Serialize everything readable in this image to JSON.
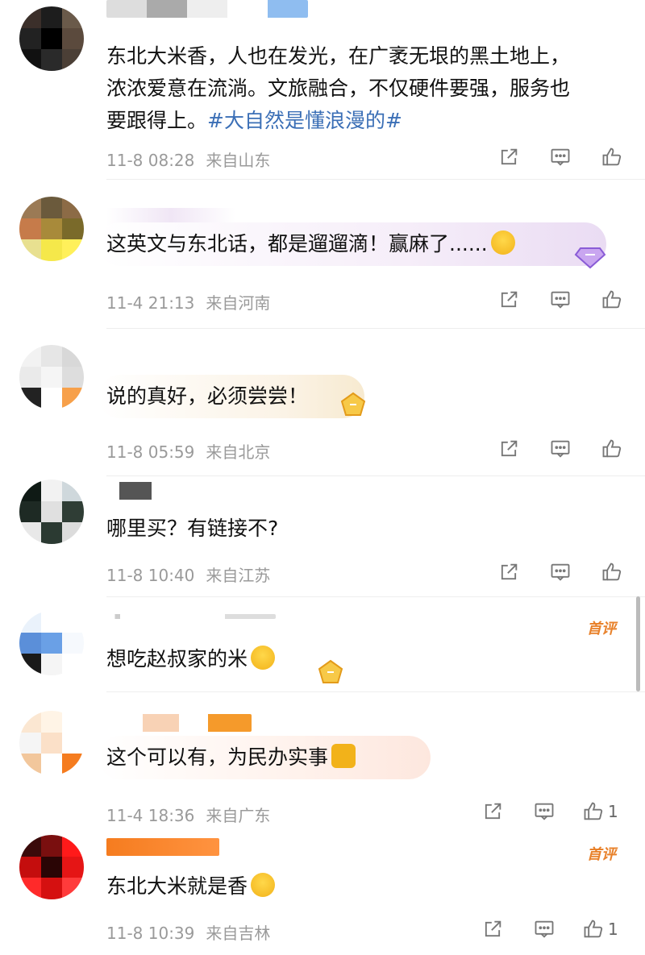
{
  "comments": [
    {
      "text_parts": [
        "东北大米香，人也在发光，在广袤无垠的黑土地上，",
        "浓浓爱意在流淌。文旅融合，不仅硬件要强，服务也",
        "要跟得上。"
      ],
      "tag": "#大自然是懂浪漫的#",
      "time": "11-8 08:28",
      "location": "来自山东"
    },
    {
      "text": "这英文与东北话，都是遛遛滴！赢麻了......",
      "time": "11-4 21:13",
      "location": "来自河南"
    },
    {
      "text": "说的真好，必须尝尝！",
      "time": "11-8 05:59",
      "location": "来自北京"
    },
    {
      "text": "哪里买？有链接不?",
      "time": "11-8 10:40",
      "location": "来自江苏"
    },
    {
      "text": "想吃赵叔家的米",
      "badge": "首评"
    },
    {
      "text": "这个可以有，为民办实事",
      "time": "11-4 18:36",
      "location": "来自广东",
      "likes": "1"
    },
    {
      "text": "东北大米就是香",
      "badge": "首评",
      "time": "11-8 10:39",
      "location": "来自吉林",
      "likes": "1"
    }
  ],
  "icons": {
    "share": "share-icon",
    "comment": "comment-icon",
    "like": "like-icon"
  },
  "colors": {
    "hashtag": "#3b6fb6",
    "badge": "#e8812a",
    "meta": "#9a9a9a"
  }
}
